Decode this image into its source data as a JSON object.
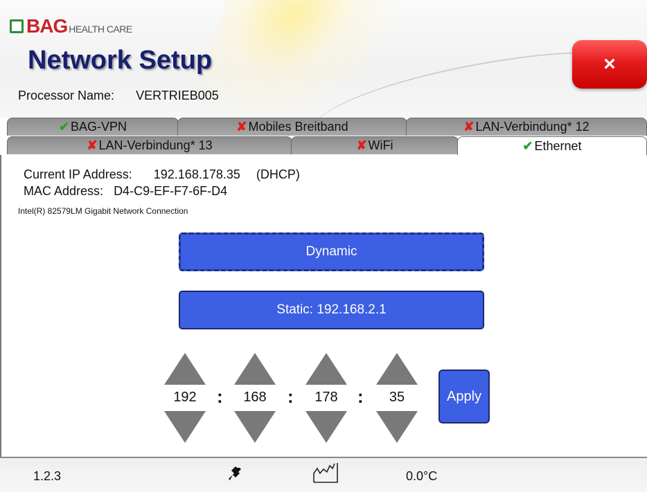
{
  "logo": {
    "brand": "BAG",
    "suffix": "HEALTH CARE"
  },
  "header": {
    "title": "Network Setup",
    "processor_label": "Processor Name:",
    "processor_value": "VERTRIEB005"
  },
  "close_button": {
    "icon": "close-icon",
    "glyph": "×"
  },
  "tabs": [
    {
      "status": "ok",
      "label": "BAG-VPN"
    },
    {
      "status": "error",
      "label": "Mobiles Breitband"
    },
    {
      "status": "error",
      "label": "LAN-Verbindung* 12"
    },
    {
      "status": "error",
      "label": "LAN-Verbindung* 13"
    },
    {
      "status": "error",
      "label": "WiFi"
    },
    {
      "status": "ok",
      "label": "Ethernet",
      "active": true
    }
  ],
  "status_glyphs": {
    "ok": "✔",
    "error": "✘"
  },
  "info": {
    "ip_label": "Current IP Address:",
    "ip_value": "192.168.178.35",
    "ip_mode": "(DHCP)",
    "mac_label": "MAC Address:",
    "mac_value": "D4-C9-EF-F7-6F-D4",
    "adapter": "Intel(R) 82579LM Gigabit Network Connection"
  },
  "modes": {
    "dynamic_label": "Dynamic",
    "static_label": "Static: 192.168.2.1"
  },
  "ip_editor": {
    "octets": [
      "192",
      "168",
      "178",
      "35"
    ],
    "separator": ":",
    "apply_label": "Apply"
  },
  "footer": {
    "version": "1.2.3",
    "temperature": "0.0°C"
  },
  "colors": {
    "accent_blue": "#3c5fe3",
    "close_red": "#e41c1c",
    "title_navy": "#17206e",
    "ok_green": "#2aa12a",
    "error_red": "#e31b1b"
  }
}
